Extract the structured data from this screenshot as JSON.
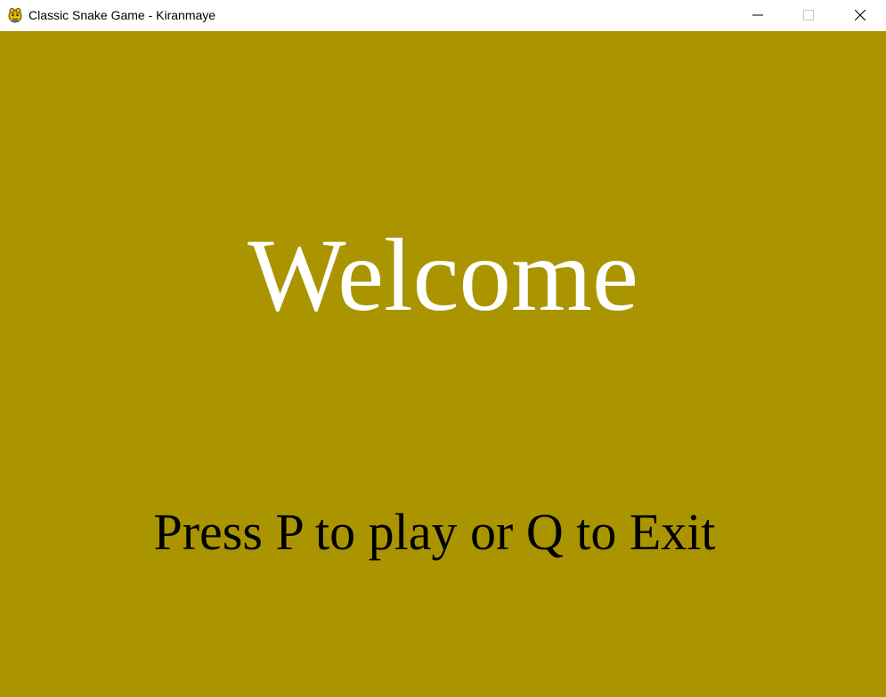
{
  "window": {
    "title": "Classic Snake Game - Kiranmaye",
    "icon": "pygame-snake-icon",
    "controls": {
      "minimize": "minimize-icon",
      "maximize": "maximize-icon",
      "close": "close-icon"
    }
  },
  "game": {
    "background_color": "#aa9500",
    "welcome_text": "Welcome",
    "welcome_color": "#ffffff",
    "instructions_text": "Press P to play or Q to Exit",
    "instructions_color": "#000000"
  }
}
